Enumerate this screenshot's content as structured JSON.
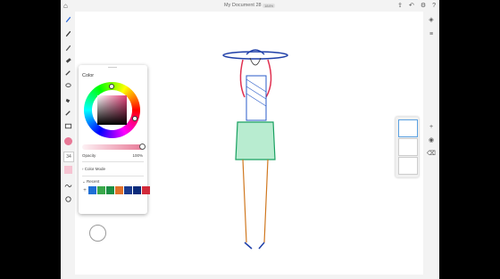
{
  "document": {
    "title": "My Document 28",
    "zoom": "184%"
  },
  "top_icons": [
    "share-icon",
    "undo-icon",
    "settings-icon",
    "help-icon"
  ],
  "left_tools": [
    "brush-icon",
    "pencil-icon",
    "paint-icon",
    "eraser-icon",
    "smudge-icon",
    "lasso-icon",
    "fill-icon",
    "eyedropper-icon",
    "image-icon"
  ],
  "brush_size": "34",
  "color_panel": {
    "title": "Color",
    "opacity_label": "Opacity",
    "opacity_value": "100%",
    "color_mode_label": "Color Mode",
    "recent_label": "Recent",
    "recent_colors": [
      "#1f6fd6",
      "#3aa84a",
      "#1a8f44",
      "#e0702a",
      "#1b3b8f",
      "#0a2a7a",
      "#d12a3a"
    ],
    "current_color": "#e87896"
  },
  "right_tools": [
    "layers-icon",
    "properties-icon",
    "add-layer-icon",
    "visibility-icon",
    "delete-icon"
  ]
}
